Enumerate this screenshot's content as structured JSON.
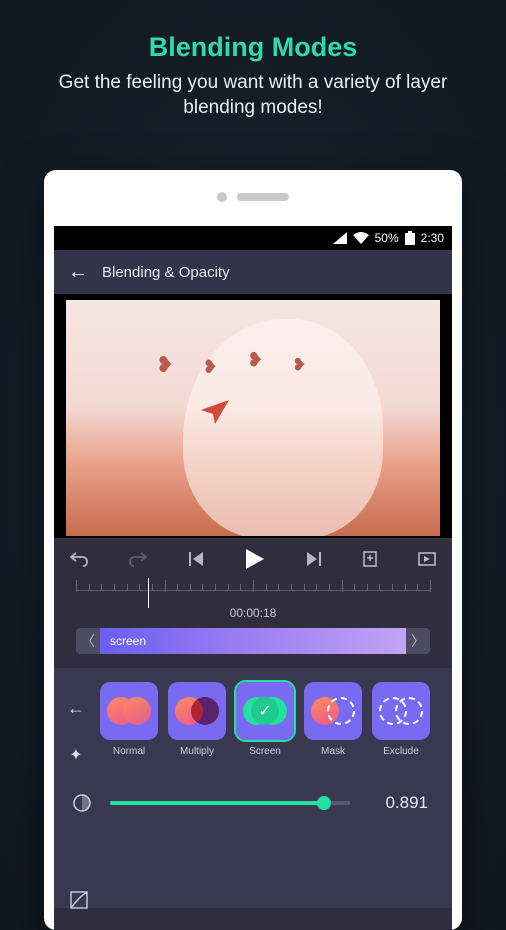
{
  "promo": {
    "title": "Blending Modes",
    "subtitle": "Get the feeling you want with a variety of layer blending modes!"
  },
  "statusbar": {
    "battery_pct": "50%",
    "time": "2:30"
  },
  "header": {
    "title": "Blending & Opacity"
  },
  "timeline": {
    "timecode": "00:00:18",
    "clip_label": "screen"
  },
  "modes": {
    "items": [
      {
        "label": "Normal",
        "kind": "norm"
      },
      {
        "label": "Multiply",
        "kind": "mult"
      },
      {
        "label": "Screen",
        "kind": "scrn",
        "selected": true
      },
      {
        "label": "Mask",
        "kind": "mask"
      },
      {
        "label": "Exclude",
        "kind": "excl"
      }
    ]
  },
  "opacity": {
    "value": "0.891",
    "percent": 89.1
  },
  "icons": {
    "back": "←",
    "undo": "↶",
    "redo": "↷",
    "prev": "|◀",
    "play": "▶",
    "next": "▶|",
    "bookmark": "☐",
    "loop": "↻",
    "nudge_left": "〈",
    "nudge_right": "〉",
    "side_back": "←",
    "sparkle": "✦",
    "check": "✓",
    "crop": "⿻"
  }
}
